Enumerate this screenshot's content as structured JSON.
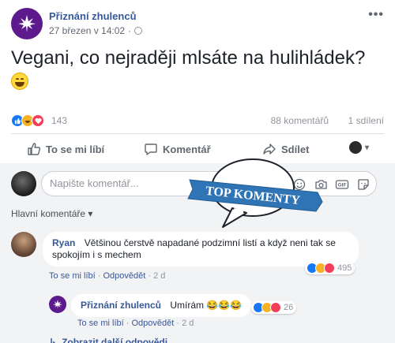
{
  "post": {
    "page_name": "Přiznání zhulenců",
    "date": "27 březen v 14:02",
    "meta_sep": "·",
    "more_label": "•••",
    "text": "Vegani, co nejraději mlsáte na hulihládek?",
    "reaction_count": "143",
    "comment_count": "88 komentářů",
    "share_count": "1 sdílení"
  },
  "actions": {
    "like": "To se mi líbí",
    "comment": "Komentář",
    "share": "Sdílet"
  },
  "composer": {
    "placeholder": "Napište komentář..."
  },
  "badge": {
    "label": "TOP KOMENTY"
  },
  "sort": {
    "label": "Hlavní komentáře",
    "caret": "▾"
  },
  "comments": [
    {
      "author": "Ryan",
      "text": "Většinou čerstvě napadané podzimní listí a když neni tak se spokojím i s mechem",
      "like_label": "To se mi líbí",
      "reply_label": "Odpovědět",
      "time": "2 d",
      "reaction_count": "495"
    },
    {
      "author": "Přiznání zhulenců",
      "text": "Umírám 😂😂😂",
      "like_label": "To se mi líbí",
      "reply_label": "Odpovědět",
      "time": "2 d",
      "reaction_count": "26"
    }
  ],
  "replies_link": "Zobrazit další odpovědi",
  "dot": "·",
  "colors": {
    "link": "#365899",
    "like": "#1877f2",
    "haha": "#f7b125",
    "love": "#f33e58",
    "badge": "#2f74b5"
  },
  "icons": [
    "page-logo-icon",
    "globe-icon",
    "like-icon",
    "comment-icon",
    "share-icon",
    "emoji-icon",
    "camera-icon",
    "gif-icon",
    "sticker-icon"
  ]
}
